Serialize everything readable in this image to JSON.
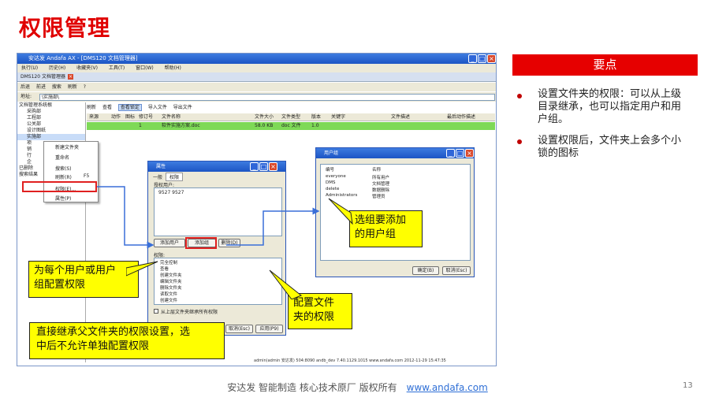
{
  "slide": {
    "title": "权限管理",
    "page_number": "13"
  },
  "app_window": {
    "title": "安达发 Andafa AX - [DMS120 文档管理器]",
    "menu": [
      "执行(U)",
      "历史(H)",
      "收藏夹(V)",
      "工具(T)",
      "窗口(W)",
      "帮助(H)"
    ],
    "doc_tab": "DMS120 文档管理器",
    "nav": [
      "后退",
      "前进",
      "搜索",
      "刷新",
      "?"
    ],
    "address_label": "地址:",
    "address_value": "\\实施部\\",
    "tree": [
      "文档管理系统根",
      "采购部",
      "工程部",
      "公关部",
      "设计图纸",
      "项",
      "销",
      "行",
      "企",
      "已删除",
      "搜索结果"
    ],
    "file_toolbar": [
      "刷新",
      "查看",
      "查看锁定",
      "导入文件",
      "导出文件"
    ],
    "table_headers": [
      "来源",
      "动作",
      "图标",
      "修订号",
      "文件名称",
      "文件大小",
      "文件类型",
      "版本",
      "关键字",
      "文件描述",
      "最后动作描述"
    ],
    "table_row": {
      "rev": "1",
      "name": "软件实施方案.doc",
      "size": "58.0 KB",
      "type": "doc 文件",
      "version": "1.0"
    },
    "status": "admin(admin 安达发)   504:8090   andb_dev   7.40.1129.1015   www.andafa.com   2012-11-29 15:47:35"
  },
  "context_menu": {
    "items": [
      "新建文件夹",
      "重命名",
      "搜索(S)",
      "刷新(R)",
      "权限(E)...",
      "属性(P)"
    ],
    "refresh_shortcut": "F5"
  },
  "properties_dialog": {
    "title": "属性",
    "tabs": [
      "一般",
      "权限"
    ],
    "auth_users_label": "授权用户:",
    "user_entry": "9527 9527",
    "add_user": "添加用户",
    "add_group": "添加组",
    "delete": "删除(D)",
    "perm_label": "权限:",
    "permissions": [
      "完全控制",
      "查看",
      "创建文件夹",
      "编辑文件夹",
      "删除文件夹",
      "读取文件",
      "创建文件"
    ],
    "inherit_label": "从上层文件夹继承所有权限",
    "cancel": "取消(Esc)",
    "apply": "应用(P9)"
  },
  "group_dialog": {
    "title": "用户组",
    "col_code": "编号",
    "col_name": "名称",
    "rows": [
      {
        "code": "everyone",
        "name": "所有用户"
      },
      {
        "code": "DMS",
        "name": "文档管理"
      },
      {
        "code": "delete",
        "name": "数据删除"
      },
      {
        "code": "Administrators",
        "name": "管理员"
      }
    ],
    "ok": "确定(B)",
    "cancel": "取消(Esc)"
  },
  "callouts": {
    "select_group": "选组要添加\n的用户组",
    "per_user": "为每个用户或用户\n组配置权限",
    "folder_perm": "配置文件\n夹的权限",
    "inherit": "直接继承父文件夹的权限设置，选\n中后不允许单独配置权限"
  },
  "key_points": {
    "heading": "要点",
    "items": [
      "设置文件夹的权限：可以从上级目录继承，也可以指定用户和用户组。",
      "设置权限后，文件夹上会多个小锁的图标"
    ]
  },
  "footer": {
    "text": "安达发   智能制造 核心技术原厂   版权所有",
    "link": "www.andafa.com"
  },
  "colors": {
    "title_red": "#e00000",
    "accent_red": "#e60000",
    "callout_yellow": "#ffff00",
    "row_green": "#7ed957",
    "arrow_blue": "#3a6fd8"
  }
}
